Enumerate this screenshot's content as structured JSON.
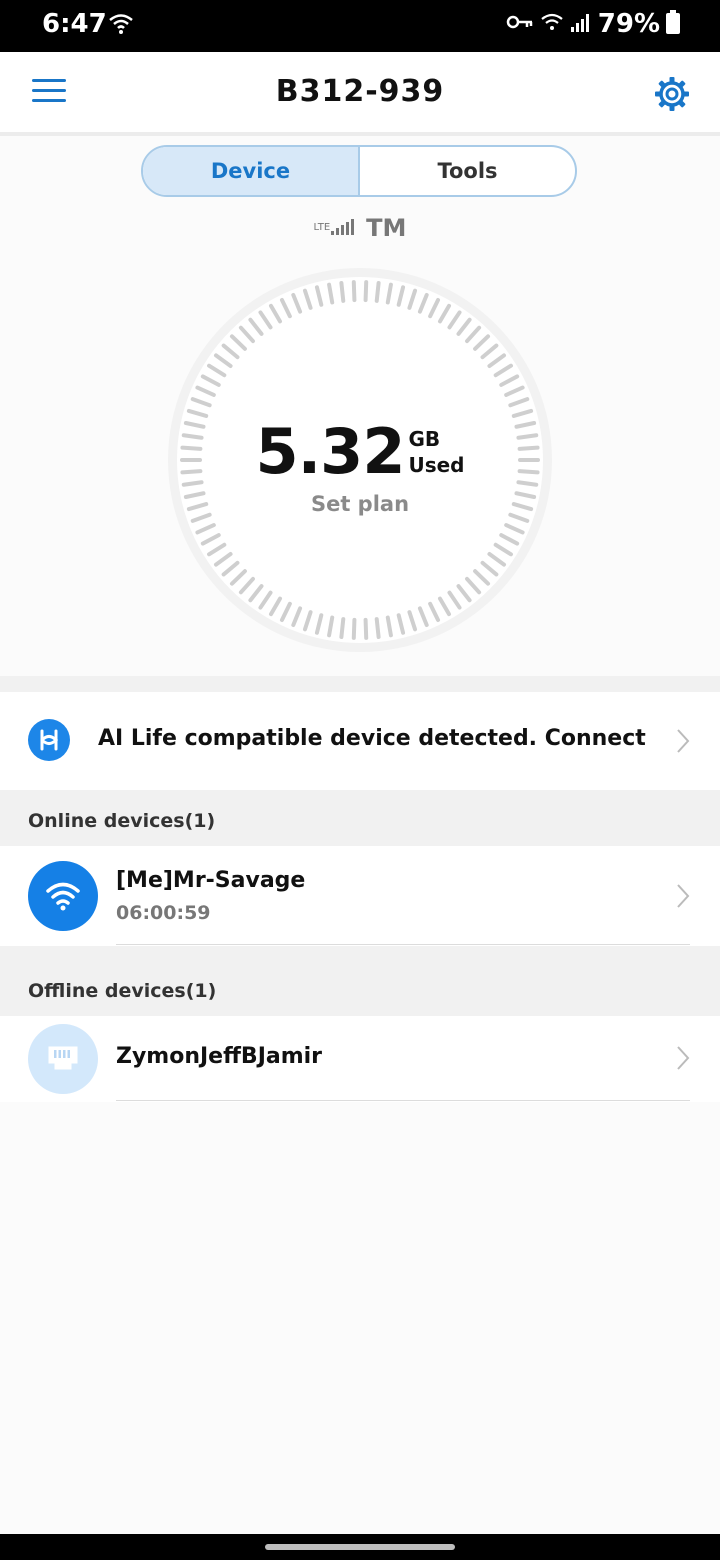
{
  "status_bar": {
    "time": "6:47",
    "battery": "79%",
    "icons": [
      "wifi-icon",
      "vpn-key-icon",
      "wifi-calling-icon",
      "cell-signal-icon",
      "battery-icon"
    ]
  },
  "app_bar": {
    "title": "B312-939",
    "icons": [
      "menu-icon",
      "gear-icon"
    ],
    "accent": "#1976c8"
  },
  "tabs": [
    {
      "label": "Device",
      "active": true
    },
    {
      "label": "Tools",
      "active": false
    }
  ],
  "network": {
    "type": "LTE",
    "carrier": "TM"
  },
  "usage": {
    "value": "5.32",
    "unit": "GB",
    "label": "Used",
    "action": "Set plan"
  },
  "ai_banner": {
    "text": "AI Life compatible device detected. Connect",
    "icon": "ai-life-icon"
  },
  "online": {
    "header": "Online devices(1)",
    "devices": [
      {
        "name": "[Me]Mr-Savage",
        "duration": "06:00:59",
        "icon": "wifi-icon",
        "color": "#1580e6"
      }
    ]
  },
  "offline": {
    "header": "Offline devices(1)",
    "devices": [
      {
        "name": "ZymonJeffBJamir",
        "icon": "ethernet-icon",
        "color": "#d3e8fb"
      }
    ]
  }
}
